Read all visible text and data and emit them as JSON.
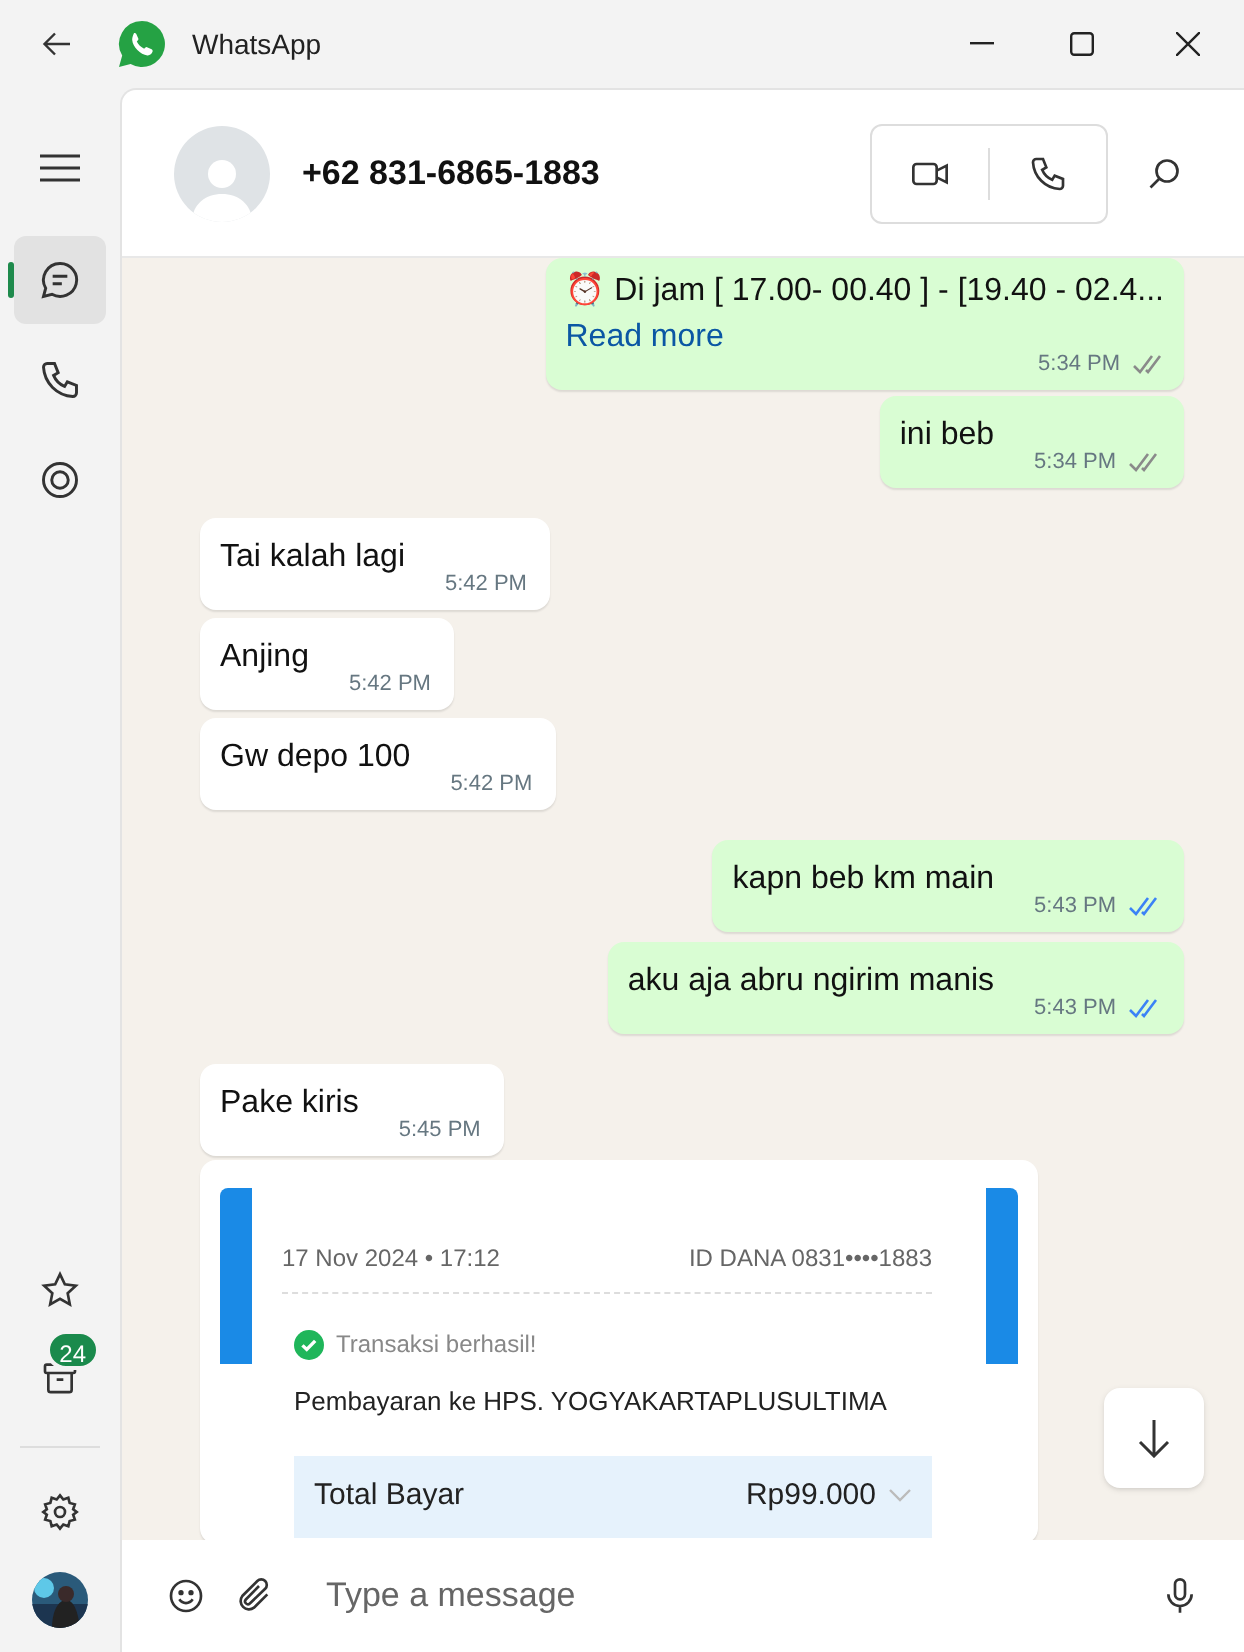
{
  "window": {
    "title": "WhatsApp"
  },
  "sidebar": {
    "items": [
      {
        "kind": "chats",
        "selected": true
      },
      {
        "kind": "calls",
        "selected": false
      },
      {
        "kind": "status",
        "selected": false
      }
    ],
    "archived_badge": "24"
  },
  "header": {
    "contact": "+62 831-6865-1883"
  },
  "messages": [
    {
      "kind": "text",
      "outgoing": true,
      "lines": [
        "⏰ Di jam [ 17.00- 00.40 ] - [19.40 - 02.4..."
      ],
      "link": "Read more",
      "time": "5:34 PM",
      "read": false
    },
    {
      "kind": "text",
      "outgoing": true,
      "lines": [
        "ini beb"
      ],
      "time": "5:34 PM",
      "read": false
    },
    {
      "kind": "text",
      "outgoing": false,
      "lines": [
        "Tai kalah lagi"
      ],
      "time": "5:42 PM"
    },
    {
      "kind": "text",
      "outgoing": false,
      "lines": [
        "Anjing"
      ],
      "time": "5:42 PM"
    },
    {
      "kind": "text",
      "outgoing": false,
      "lines": [
        "Gw depo 100"
      ],
      "time": "5:42 PM"
    },
    {
      "kind": "text",
      "outgoing": true,
      "lines": [
        "kapn beb km main"
      ],
      "time": "5:43 PM",
      "read": true
    },
    {
      "kind": "text",
      "outgoing": true,
      "lines": [
        "aku aja abru ngirim manis"
      ],
      "time": "5:43 PM",
      "read": true
    },
    {
      "kind": "text",
      "outgoing": false,
      "lines": [
        "Pake kiris"
      ],
      "time": "5:45 PM"
    },
    {
      "kind": "receipt",
      "outgoing": false,
      "date": "17 Nov 2024 • 17:12",
      "account": "ID DANA 0831••••1883",
      "status": "Transaksi berhasil!",
      "description": "Pembayaran ke HPS. YOGYAKARTAPLUSULTIMA",
      "total_label": "Total Bayar",
      "total_value": "Rp99.000"
    }
  ],
  "composer": {
    "placeholder": "Type a message"
  }
}
